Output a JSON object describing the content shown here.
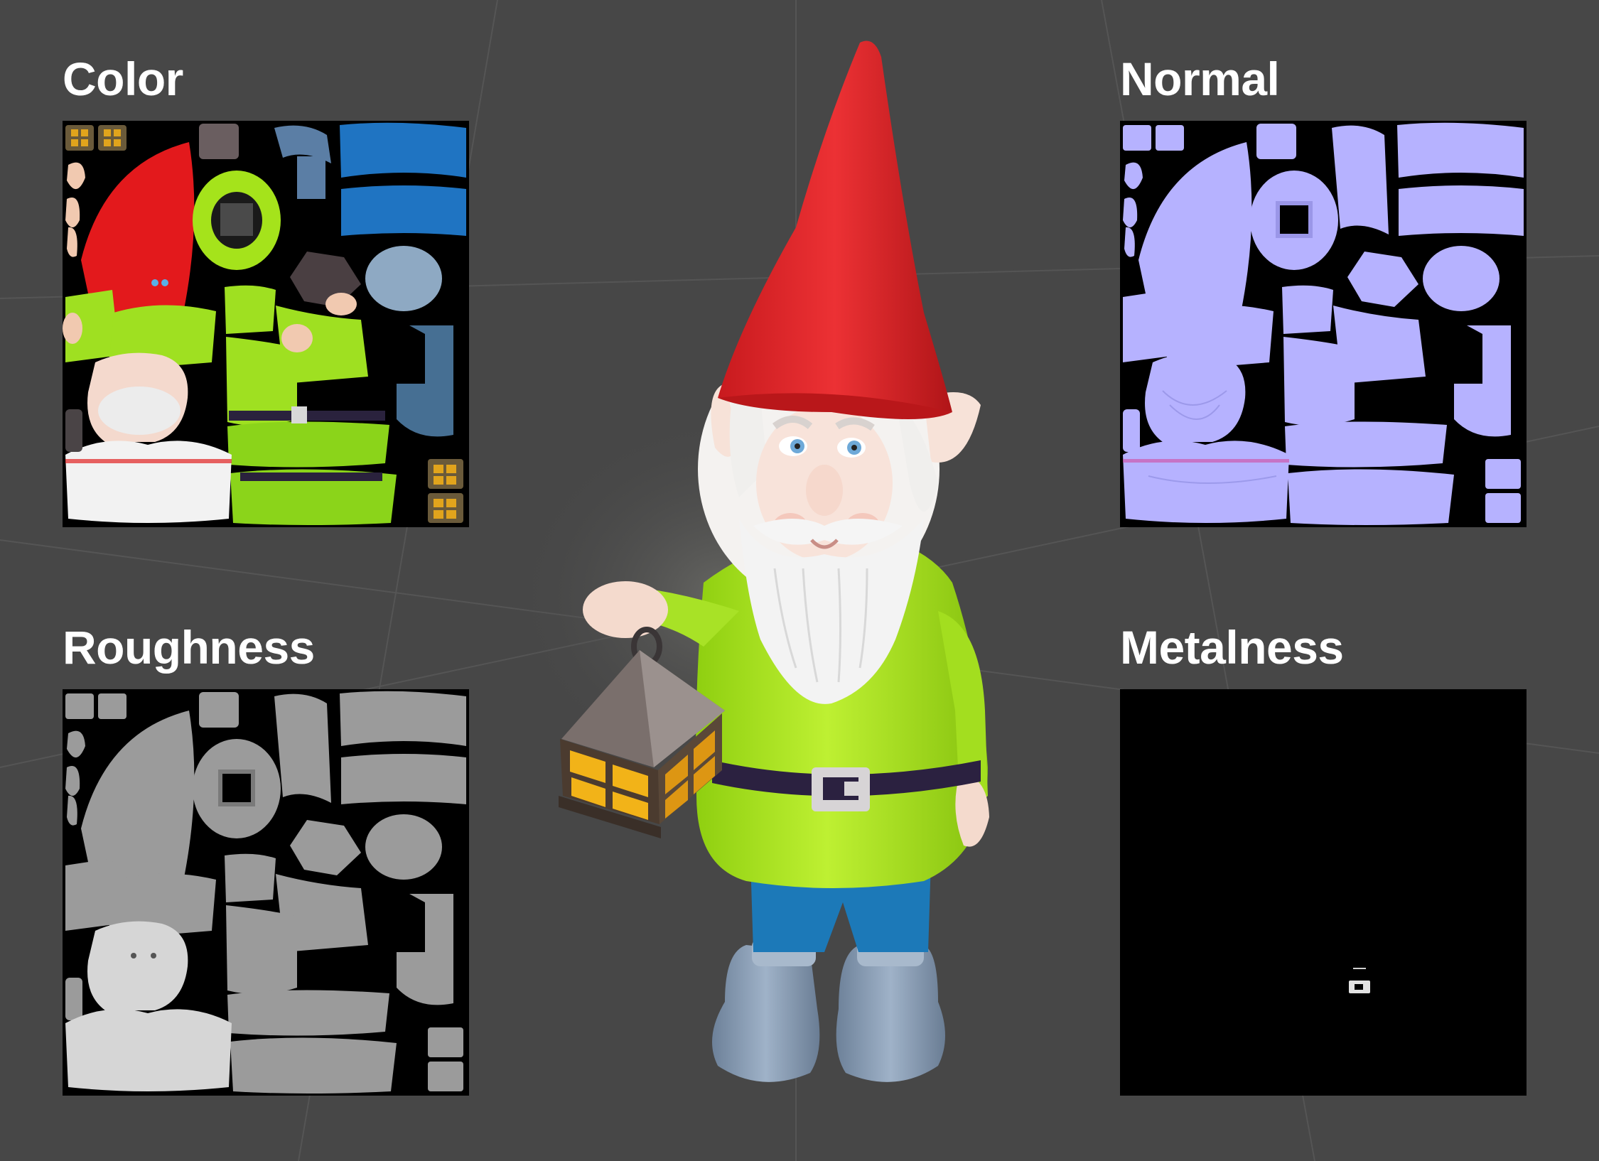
{
  "maps": {
    "color": {
      "label": "Color"
    },
    "normal": {
      "label": "Normal"
    },
    "roughness": {
      "label": "Roughness"
    },
    "metalness": {
      "label": "Metalness"
    }
  },
  "palette": {
    "background": "#474747",
    "hat": "#e5282b",
    "shirt": "#a6e619",
    "pants": "#1f7fbf",
    "boots": "#8fa4bd",
    "beard": "#f2f2f2",
    "normal_map": "#b9b7ff",
    "roughness_map": "#9a9a9a"
  }
}
